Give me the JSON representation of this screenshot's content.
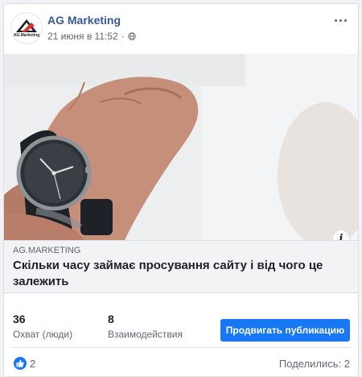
{
  "page": {
    "name": "AG Marketing",
    "avatar_text": "AG.Marketing"
  },
  "post": {
    "timestamp": "21 июня в 11:52",
    "separator": "·",
    "privacy_icon": "globe-icon"
  },
  "link": {
    "domain": "AG.MARKETING",
    "title": "Скільки часу займає просування сайту і від чого це залежить"
  },
  "stats": {
    "reach": {
      "value": "36",
      "label": "Охват (люди)"
    },
    "engagement": {
      "value": "8",
      "label": "Взаимодействия"
    }
  },
  "actions": {
    "promote_label": "Продвигать публикацию"
  },
  "reactions": {
    "likes": "2",
    "shares": "Поделились: 2"
  },
  "colors": {
    "link_name": "#385898",
    "accent": "#1877f2",
    "logo_red": "#e0322d"
  }
}
